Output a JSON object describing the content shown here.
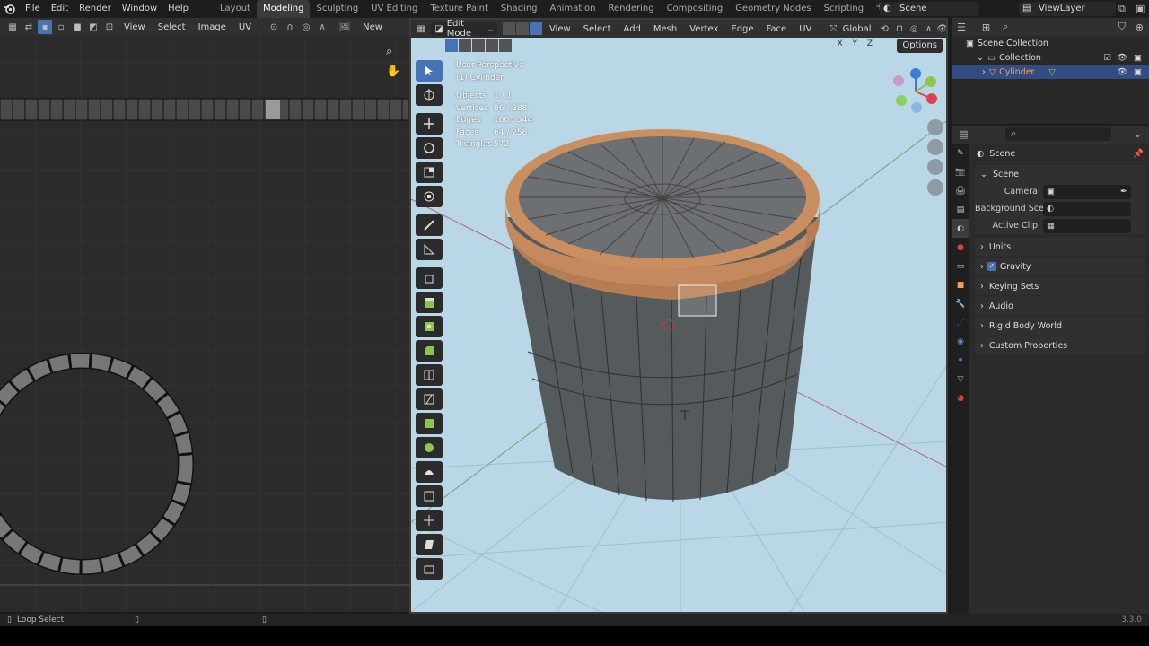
{
  "topbar": {
    "menus": [
      "File",
      "Edit",
      "Render",
      "Window",
      "Help"
    ],
    "workspaces": [
      "Layout",
      "Modeling",
      "Sculpting",
      "UV Editing",
      "Texture Paint",
      "Shading",
      "Animation",
      "Rendering",
      "Compositing",
      "Geometry Nodes",
      "Scripting"
    ],
    "active_workspace": "Modeling",
    "add_tab": "+",
    "scene": "Scene",
    "view_layer": "ViewLayer"
  },
  "uv_editor": {
    "menus": [
      "View",
      "Select",
      "Image",
      "UV"
    ],
    "new_label": "New"
  },
  "viewport": {
    "mode": "Edit Mode",
    "menus": [
      "View",
      "Select",
      "Add",
      "Mesh",
      "Vertex",
      "Edge",
      "Face",
      "UV"
    ],
    "orientation": "Global",
    "options_label": "Options",
    "axis_letters": "X Y Z",
    "perspective_label": "User Perspective",
    "object_label": "(1) Cylinder",
    "stats": [
      {
        "key": "Objects",
        "value": "1 / 1"
      },
      {
        "key": "Vertices",
        "value": "96 / 288"
      },
      {
        "key": "Edges",
        "value": "160 / 544"
      },
      {
        "key": "Faces",
        "value": "64 / 258"
      },
      {
        "key": "Triangles",
        "value": "572"
      }
    ]
  },
  "outliner": {
    "root": "Scene Collection",
    "collection": "Collection",
    "object": "Cylinder"
  },
  "properties": {
    "context": "Scene",
    "panel_title": "Scene",
    "camera_label": "Camera",
    "background_label": "Background Sce...",
    "active_clip_label": "Active Clip",
    "sections": [
      "Units",
      "Gravity",
      "Keying Sets",
      "Audio",
      "Rigid Body World",
      "Custom Properties"
    ]
  },
  "statusbar": {
    "action": "Loop Select",
    "version": "3.3.0"
  },
  "colors": {
    "accent": "#4772b3",
    "selection": "#f0a060",
    "viewport_bg": "#bad7e7"
  }
}
